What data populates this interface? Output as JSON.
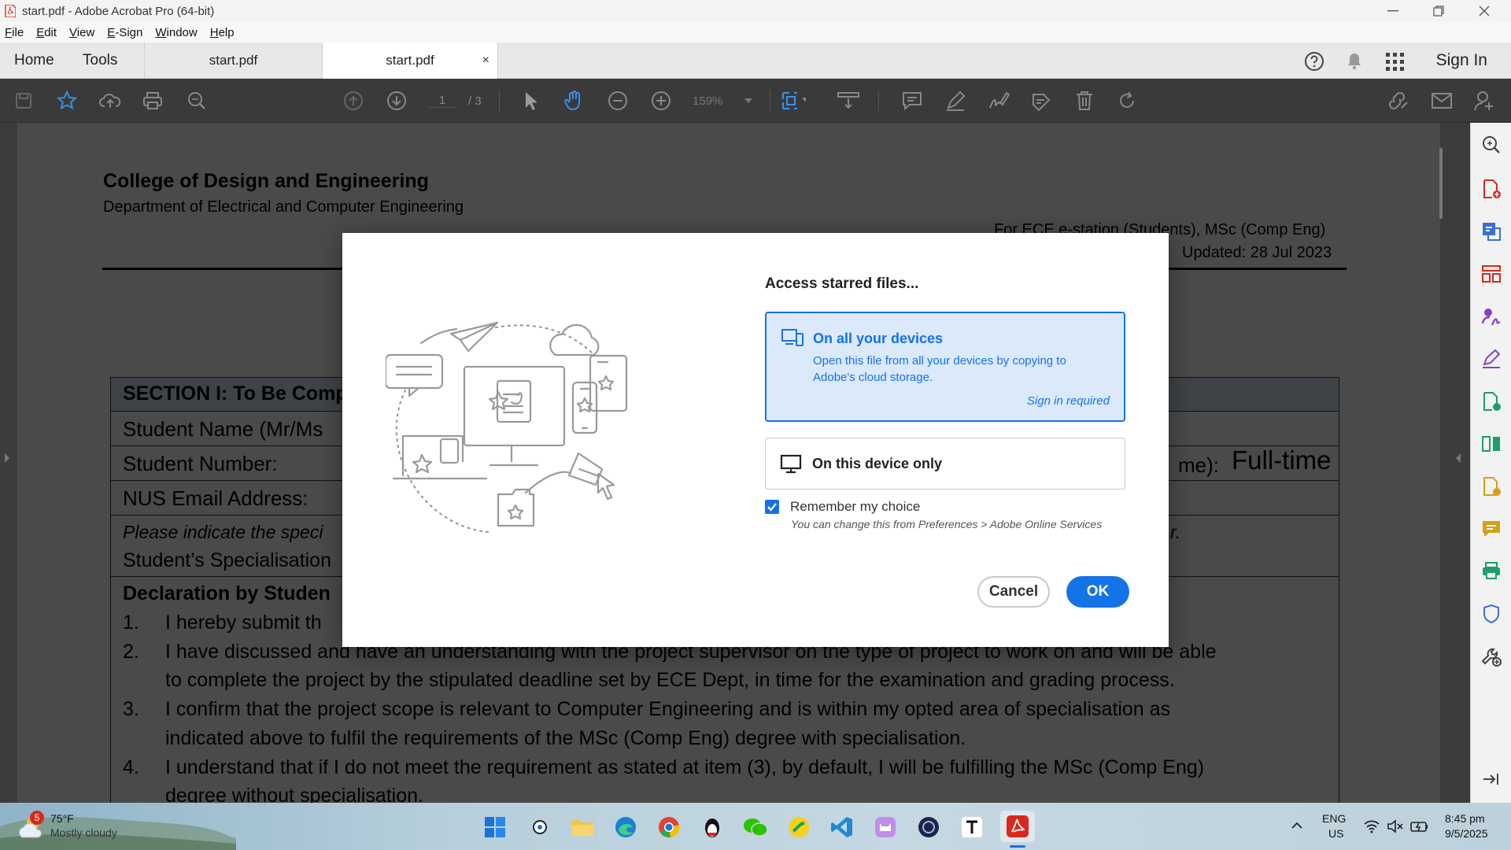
{
  "window": {
    "title": "start.pdf - Adobe Acrobat Pro (64-bit)"
  },
  "menu": [
    "File",
    "Edit",
    "View",
    "E-Sign",
    "Window",
    "Help"
  ],
  "tabs": {
    "home": "Home",
    "tools": "Tools",
    "doc1": "start.pdf",
    "doc2": "start.pdf",
    "close": "×"
  },
  "header": {
    "sign_in": "Sign In"
  },
  "toolbar": {
    "page_current": "1",
    "page_total": "/ 3",
    "zoom": "159%"
  },
  "document": {
    "college": "College of Design and Engineering",
    "department": "Department of Electrical and Computer Engineering",
    "for_line": "For ECE e-station (Students), MSc (Comp Eng)",
    "updated": "Updated: 28 Jul 2023",
    "section": "SECTION I: To Be Comp",
    "student_name": "Student Name (Mr/Ms",
    "student_number": "Student Number:",
    "mode_suffix": "me):",
    "full_time": "Full-time",
    "email": "NUS Email Address:",
    "indicate": "Please indicate the speci",
    "indicate_end": "r.",
    "specialisation": "Student’s Specialisation",
    "declaration": "Declaration by Studen",
    "item1_num": "1.",
    "item1": "I hereby submit th",
    "item2_num": "2.",
    "item2a": "I have discussed and have an understanding with the project supervisor on the type of project to work on and will be able",
    "item2b": "to complete the project by the stipulated deadline set by ECE Dept, in time for the examination and grading process.",
    "item3_num": "3.",
    "item3a": "I confirm that the project scope is relevant to Computer Engineering and is within my opted area of specialisation as",
    "item3b": "indicated above to fulfil the requirements of the MSc (Comp Eng) degree with specialisation.",
    "item4_num": "4.",
    "item4a": "I understand that if I do not meet the requirement as stated at item (3), by default, I will be fulfilling the MSc (Comp Eng)",
    "item4b": "degree without specialisation."
  },
  "dialog": {
    "title": "Access starred files...",
    "option_cloud": {
      "title": "On all your devices",
      "description": "Open this file from all your devices by copying to Adobe's cloud storage.",
      "note": "Sign in required"
    },
    "option_device": {
      "title": "On this device only"
    },
    "remember": "Remember my choice",
    "remember_hint": "You can change this from Preferences > Adobe Online Services",
    "cancel": "Cancel",
    "ok": "OK"
  },
  "taskbar": {
    "weather_badge": "5",
    "weather_temp": "75°F",
    "weather_desc": "Mostly cloudy",
    "lang": "ENG",
    "region": "US",
    "time": "8:45 pm",
    "date": "9/5/2025"
  },
  "colors": {
    "accent": "#1473e6",
    "toolbar_bg": "#3a3a3a",
    "doc_bg": "#3c3c3c",
    "acrobat_red": "#d9281c"
  }
}
